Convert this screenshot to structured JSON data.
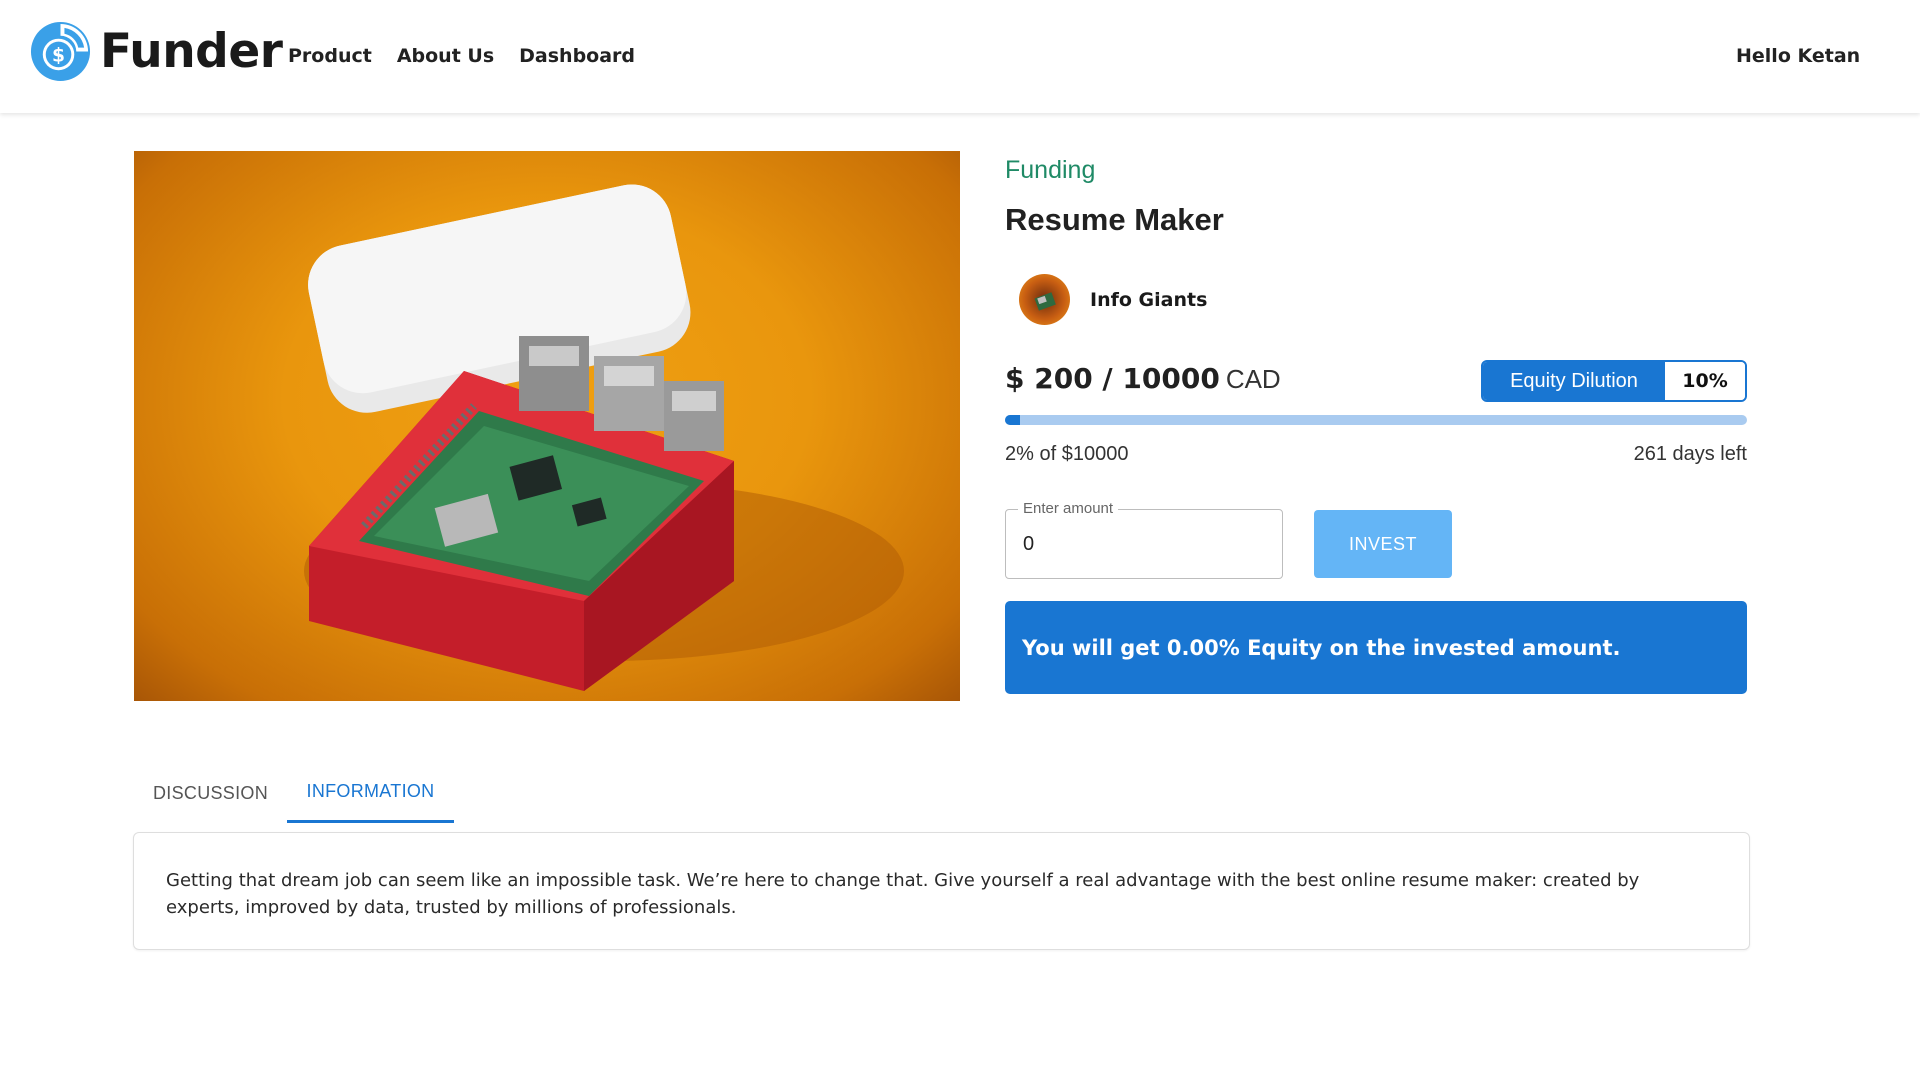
{
  "header": {
    "brand": "Funder",
    "nav": [
      {
        "label": "Product"
      },
      {
        "label": "About Us"
      },
      {
        "label": "Dashboard"
      }
    ],
    "greeting": "Hello Ketan"
  },
  "project": {
    "status": "Funding",
    "title": "Resume Maker",
    "company": "Info Giants",
    "amount": "$ 200 / 10000",
    "currency": "CAD",
    "equity_label": "Equity Dilution",
    "equity_value": "10%",
    "progress_fraction": 0.02,
    "progress_text": "2% of $10000",
    "days_left": "261 days left"
  },
  "invest": {
    "field_label": "Enter amount",
    "field_value": "0",
    "button_label": "INVEST",
    "equity_message": "You will get 0.00% Equity on the invested amount."
  },
  "tabs": [
    {
      "label": "DISCUSSION"
    },
    {
      "label": "INFORMATION"
    }
  ],
  "information": {
    "text": "Getting that dream job can seem like an impossible task. We’re here to change that. Give yourself a real advantage with the best online resume maker: created by experts, improved by data, trusted by millions of professionals."
  },
  "colors": {
    "primary": "#1976d2",
    "primary_light": "#64b5f6",
    "progress_track": "#a9cbf0",
    "status_green": "#1f8a66",
    "logo_blue": "#3aa0e8"
  },
  "icons": {
    "logo": "dollar-coin-icon"
  }
}
